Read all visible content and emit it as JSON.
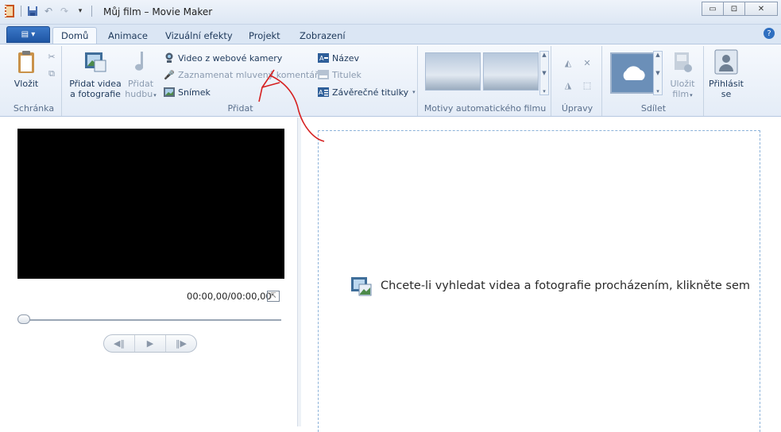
{
  "window": {
    "title": "Můj film – Movie Maker",
    "buttons": {
      "minimize": "▭",
      "maximize": "⊡",
      "close": "✕"
    }
  },
  "tabs": [
    {
      "label": "Domů",
      "active": true
    },
    {
      "label": "Animace",
      "active": false
    },
    {
      "label": "Vizuální efekty",
      "active": false
    },
    {
      "label": "Projekt",
      "active": false
    },
    {
      "label": "Zobrazení",
      "active": false
    }
  ],
  "ribbon": {
    "clipboard": {
      "label": "Schránka",
      "paste": "Vložit"
    },
    "add": {
      "label": "Přidat",
      "add_videos_line1": "Přidat videa",
      "add_videos_line2": "a fotografie",
      "add_music_line1": "Přidat",
      "add_music_line2": "hudbu",
      "webcam": "Video z webové kamery",
      "narration": "Zaznamenat mluvený komentář",
      "snapshot": "Snímek",
      "title": "Název",
      "caption": "Titulek",
      "credits": "Závěrečné titulky"
    },
    "themes": {
      "label": "Motivy automatického filmu"
    },
    "editing": {
      "label": "Úpravy"
    },
    "share": {
      "label": "Sdílet",
      "save_line1": "Uložit",
      "save_line2": "film",
      "signin_line1": "Přihlásit",
      "signin_line2": "se"
    }
  },
  "player": {
    "timecode": "00:00,00/00:00,00",
    "progress": 0
  },
  "storyboard": {
    "hint": "Chcete-li vyhledat videa a fotografie procházením, klikněte sem"
  },
  "colors": {
    "accent": "#2f6fc0",
    "annotation": "#d62020"
  }
}
